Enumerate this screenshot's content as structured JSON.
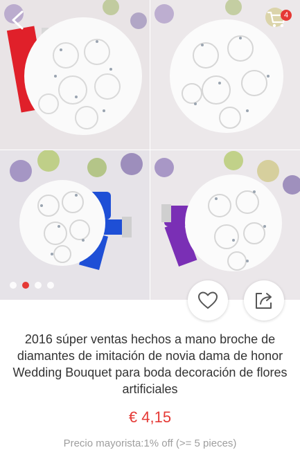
{
  "product": {
    "title": "2016 súper ventas hechos a mano broche de diamantes de imitación de novia dama de honor Wedding Bouquet para boda decoración de flores artificiales",
    "price": "€ 4,15",
    "wholesale": "Precio mayorista:1% off (>= 5 pieces)"
  },
  "cart": {
    "count": "4"
  },
  "gallery": {
    "images": [
      {
        "icon": "bouquet-red-ribbon-image",
        "ribbon": "#e0202a"
      },
      {
        "icon": "bouquet-white-image",
        "ribbon": "#ffffff"
      },
      {
        "icon": "bouquet-blue-ribbon-image",
        "ribbon": "#1e4fd6"
      },
      {
        "icon": "bouquet-purple-ribbon-image",
        "ribbon": "#7a2fb5"
      }
    ],
    "page_count": 4,
    "active_page": 2
  },
  "colors": {
    "accent": "#e53935",
    "text": "#333333",
    "muted": "#9e9e9e"
  },
  "icons": {
    "back": "back-arrow-icon",
    "cart": "cart-icon",
    "wishlist": "heart-icon",
    "share": "share-icon"
  }
}
